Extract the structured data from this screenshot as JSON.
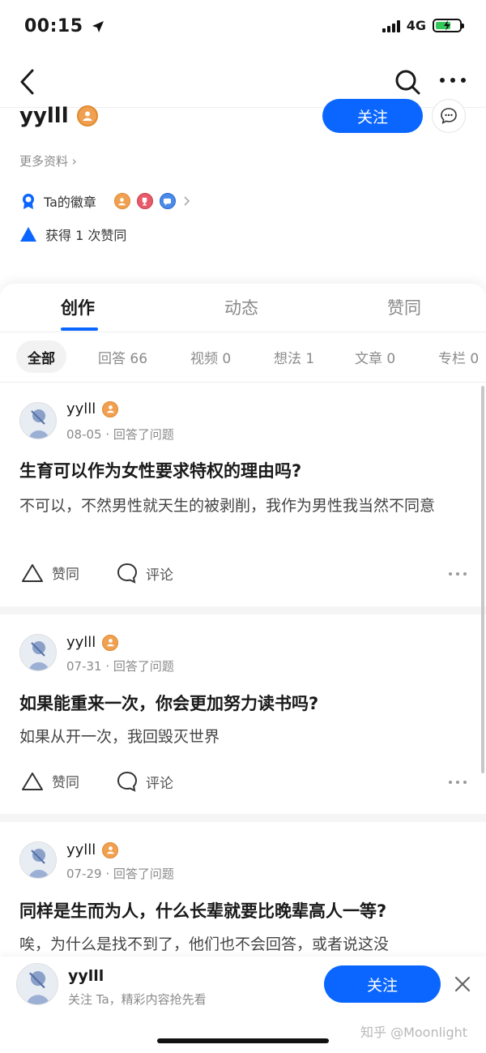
{
  "status_bar": {
    "time": "00:15",
    "network": "4G"
  },
  "nav": {
    "back_icon": "back-chevron-icon",
    "search_icon": "search-icon",
    "more_icon": "more-icon"
  },
  "profile": {
    "name": "yylll",
    "follow_label": "关注",
    "more_info_label": "更多资料 ›",
    "badges_label": "Ta的徽章",
    "likes_text": "获得 1 次赞同"
  },
  "tabs": [
    {
      "label": "创作",
      "active": true
    },
    {
      "label": "动态",
      "active": false
    },
    {
      "label": "赞同",
      "active": false
    }
  ],
  "filters": [
    {
      "label": "全部",
      "active": true
    },
    {
      "label": "回答 66",
      "active": false
    },
    {
      "label": "视频 0",
      "active": false
    },
    {
      "label": "想法 1",
      "active": false
    },
    {
      "label": "文章 0",
      "active": false
    },
    {
      "label": "专栏 0",
      "active": false
    }
  ],
  "feed": [
    {
      "author": "yylll",
      "meta": "08-05 · 回答了问题",
      "title": "生育可以作为女性要求特权的理由吗?",
      "excerpt": "不可以，不然男性就天生的被剥削，我作为男性我当然不同意",
      "like_label": "赞同",
      "comment_label": "评论"
    },
    {
      "author": "yylll",
      "meta": "07-31 · 回答了问题",
      "title": "如果能重来一次，你会更加努力读书吗?",
      "excerpt": "如果从开一次，我回毁灭世界",
      "like_label": "赞同",
      "comment_label": "评论"
    },
    {
      "author": "yylll",
      "meta": "07-29 · 回答了问题",
      "title": "同样是生而为人，什么长辈就要比晚辈高人一等?",
      "excerpt": "唉，为什么是找不到了，他们也不会回答，或者说这没"
    }
  ],
  "bottom_bar": {
    "name": "yylll",
    "subtitle": "关注 Ta，精彩内容抢先看",
    "follow_label": "关注"
  },
  "watermark": "知乎 @Moonlight",
  "colors": {
    "accent": "#0a66ff",
    "badge_orange": "#f0a050",
    "battery_green": "#34c759"
  }
}
